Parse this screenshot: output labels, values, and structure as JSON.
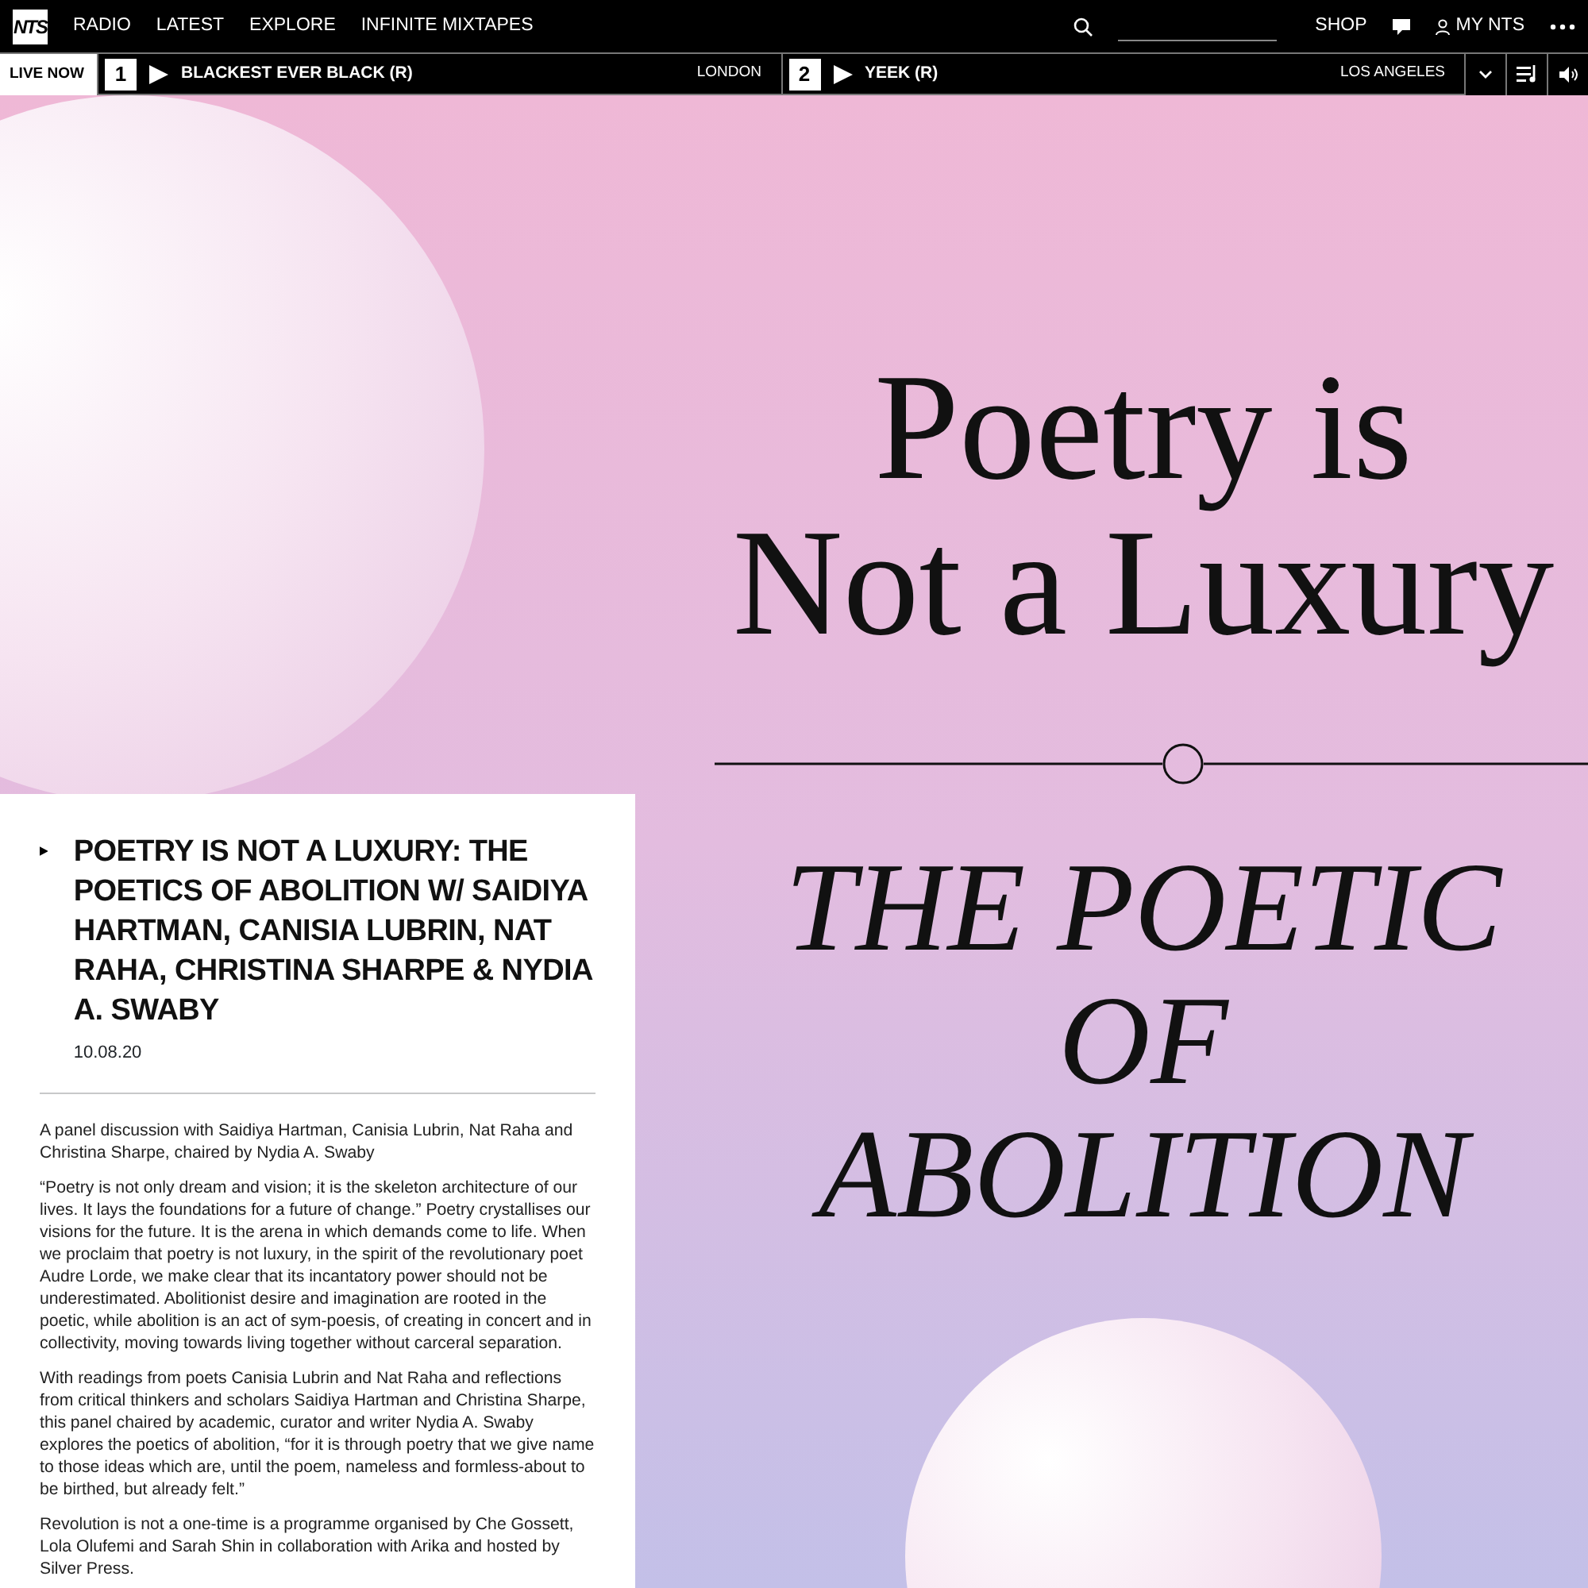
{
  "nav": {
    "logo": "NTS",
    "links": [
      "RADIO",
      "LATEST",
      "EXPLORE",
      "INFINITE MIXTAPES"
    ],
    "right_links": [
      "SHOP",
      "MY NTS"
    ]
  },
  "live_bar": {
    "label": "LIVE NOW",
    "channels": [
      {
        "number": "1",
        "show": "BLACKEST EVER BLACK (R)",
        "location": "LONDON"
      },
      {
        "number": "2",
        "show": "YEEK (R)",
        "location": "LOS ANGELES"
      }
    ]
  },
  "artwork": {
    "lines_top": [
      "Poetry is",
      "Not a Luxury"
    ],
    "lines_bottom": [
      "THE POETIC",
      "OF",
      "ABOLITION"
    ]
  },
  "episode": {
    "title": "POETRY IS NOT A LUXURY: THE POETICS OF ABOLITION W/ SAIDIYA HARTMAN, CANISIA LUBRIN, NAT RAHA, CHRISTINA SHARPE & NYDIA A. SWABY",
    "date": "10.08.20",
    "paragraphs": [
      "A panel discussion with Saidiya Hartman, Canisia Lubrin, Nat Raha and Christina Sharpe, chaired by Nydia A. Swaby",
      "“Poetry is not only dream and vision; it is the skeleton architecture of our lives. It lays the foundations for a future of change.” Poetry crystallises our visions for the future. It is the arena in which demands come to life. When we proclaim that poetry is not luxury, in the spirit of the revolutionary poet Audre Lorde, we make clear that its incantatory power should not be underestimated. Abolitionist desire and imagination are rooted in the poetic, while abolition is an act of sym-poesis, of creating in concert and in collectivity, moving towards living together without carceral separation.",
      "With readings from poets Canisia Lubrin and Nat Raha and reflections from critical thinkers and scholars Saidiya Hartman and Christina Sharpe, this panel chaired by academic, curator and writer Nydia A. Swaby explores the poetics of abolition, “for it is through poetry that we give name to those ideas which are, until the poem, nameless and formless-about to be birthed, but already felt.”",
      "Revolution is not a one-time is a programme organised by Che Gossett, Lola Olufemi and Sarah Shin in collaboration with Arika and hosted by Silver Press."
    ]
  }
}
